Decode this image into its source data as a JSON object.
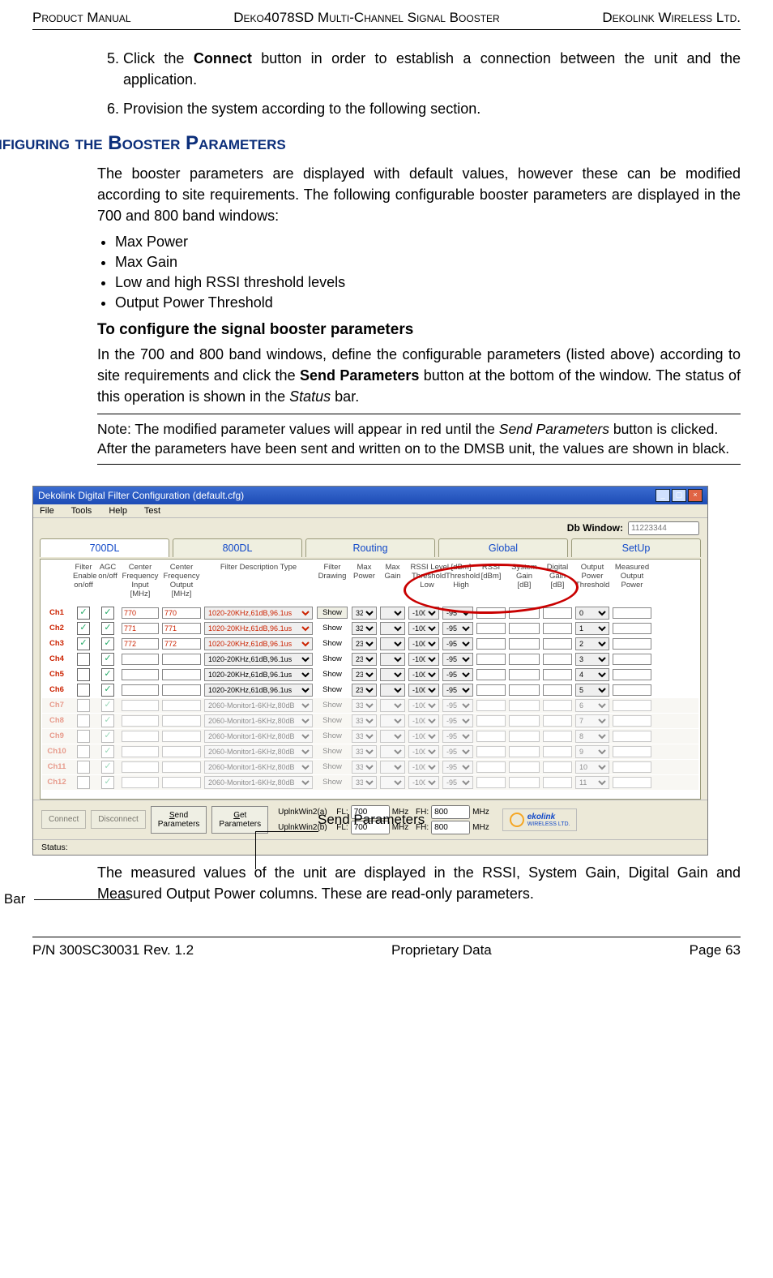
{
  "header": {
    "left": "Product Manual",
    "mid": "Deko4078SD Multi-Channel Signal Booster",
    "right": "Dekolink Wireless Ltd."
  },
  "footer": {
    "left": "P/N 300SC30031 Rev. 1.2",
    "mid": "Proprietary Data",
    "right": "Page 63"
  },
  "steps": {
    "s5a": "Click the ",
    "s5b": "Connect",
    "s5c": " button in order to establish a connection between the unit and the application.",
    "s6": "Provision the system according to the following section."
  },
  "section_title": "Configuring the Booster Parameters",
  "intro": "The booster parameters are displayed with default values, however these can be modified according to site requirements. The following configurable booster parameters are displayed in the 700 and 800 band windows:",
  "bullets": [
    "Max Power",
    "Max Gain",
    "Low and high RSSI threshold levels",
    "Output Power Threshold"
  ],
  "sub_title": "To configure the signal booster parameters",
  "sub_para_a": "In the 700 and 800 band windows, define the configurable parameters (listed above) according to site requirements and click the ",
  "sub_para_b": "Send Parameters",
  "sub_para_c": " button at the bottom of the window. The status of this operation is shown in the ",
  "sub_para_d": "Status",
  "sub_para_e": " bar.",
  "note_a": "Note: The modified parameter values will appear in red until the ",
  "note_b": "Send Parameters",
  "note_c": " button is clicked. After the parameters have been sent and written on to the DMSB unit, the values are shown in black.",
  "callout_send": "Send Parameters",
  "callout_status": "Status Bar",
  "post": "The measured values of the unit are displayed in the RSSI, System Gain, Digital Gain and Measured Output Power columns. These are read-only parameters.",
  "win": {
    "title": "Dekolink Digital Filter Configuration (default.cfg)",
    "menu": [
      "File",
      "Tools",
      "Help",
      "Test"
    ],
    "db_label": "Db Window:",
    "db_val": "11223344",
    "tabs": [
      "700DL",
      "800DL",
      "Routing",
      "Global",
      "SetUp"
    ],
    "headers": [
      "Filter Enable on/off",
      "AGC on/off",
      "Center Frequency Input [MHz]",
      "Center Frequency Output [MHz]",
      "Filter Description Type",
      "Filter Drawing",
      "Max Power",
      "Max Gain",
      "RSSI Level [dBm] Threshold Low",
      "Threshold High",
      "RSSI [dBm]",
      "System Gain [dB]",
      "Digital Gain [dB]",
      "Output Power Threshold",
      "Measured Output Power"
    ],
    "filter_norm": "1020-20KHz,61dB,96.1us",
    "filter_mon": "2060-Monitor1-6KHz,80dB",
    "freq_in": [
      "770",
      "771",
      "772"
    ],
    "rows": [
      {
        "ch": "Ch1",
        "en": true,
        "agc": true,
        "fi": "770",
        "fo": "770",
        "drwType": "button",
        "pw": "32",
        "tl": "-100",
        "th": "-95",
        "opt": "0",
        "dis": false
      },
      {
        "ch": "Ch2",
        "en": true,
        "agc": true,
        "fi": "771",
        "fo": "771",
        "drwType": "text",
        "pw": "32",
        "tl": "-100",
        "th": "-95",
        "opt": "1",
        "dis": false
      },
      {
        "ch": "Ch3",
        "en": true,
        "agc": true,
        "fi": "772",
        "fo": "772",
        "drwType": "text",
        "pw": "23",
        "tl": "-100",
        "th": "-95",
        "opt": "2",
        "dis": false
      },
      {
        "ch": "Ch4",
        "en": false,
        "agc": true,
        "fi": "",
        "fo": "",
        "drwType": "text",
        "pw": "23",
        "tl": "-100",
        "th": "-95",
        "opt": "3",
        "dis": false
      },
      {
        "ch": "Ch5",
        "en": false,
        "agc": true,
        "fi": "",
        "fo": "",
        "drwType": "text",
        "pw": "23",
        "tl": "-100",
        "th": "-95",
        "opt": "4",
        "dis": false
      },
      {
        "ch": "Ch6",
        "en": false,
        "agc": true,
        "fi": "",
        "fo": "",
        "drwType": "text",
        "pw": "23",
        "tl": "-100",
        "th": "-95",
        "opt": "5",
        "dis": false
      },
      {
        "ch": "Ch7",
        "en": false,
        "agc": true,
        "fi": "",
        "fo": "",
        "drwType": "text",
        "pw": "33",
        "tl": "-100",
        "th": "-95",
        "opt": "6",
        "dis": true
      },
      {
        "ch": "Ch8",
        "en": false,
        "agc": true,
        "fi": "",
        "fo": "",
        "drwType": "text",
        "pw": "33",
        "tl": "-100",
        "th": "-95",
        "opt": "7",
        "dis": true
      },
      {
        "ch": "Ch9",
        "en": false,
        "agc": true,
        "fi": "",
        "fo": "",
        "drwType": "text",
        "pw": "33",
        "tl": "-100",
        "th": "-95",
        "opt": "8",
        "dis": true
      },
      {
        "ch": "Ch10",
        "en": false,
        "agc": true,
        "fi": "",
        "fo": "",
        "drwType": "text",
        "pw": "33",
        "tl": "-100",
        "th": "-95",
        "opt": "9",
        "dis": true
      },
      {
        "ch": "Ch11",
        "en": false,
        "agc": true,
        "fi": "",
        "fo": "",
        "drwType": "text",
        "pw": "33",
        "tl": "-100",
        "th": "-95",
        "opt": "10",
        "dis": true
      },
      {
        "ch": "Ch12",
        "en": false,
        "agc": true,
        "fi": "",
        "fo": "",
        "drwType": "text",
        "pw": "33",
        "tl": "-100",
        "th": "-95",
        "opt": "11",
        "dis": true
      }
    ],
    "show": "Show",
    "btm": {
      "connect": "Connect",
      "disconnect": "Disconnect",
      "send": "Send Parameters",
      "get": "Get Parameters",
      "link_a": "UplnkWin2(a)",
      "link_b": "UplnkWin2(b)",
      "fl": "FL:",
      "fh": "FH:",
      "mhz": "MHz",
      "fl_val": "700",
      "fh_val": "800",
      "logo": "ekolink",
      "logo_sub": "WIRELESS LTD."
    },
    "status": "Status:"
  }
}
